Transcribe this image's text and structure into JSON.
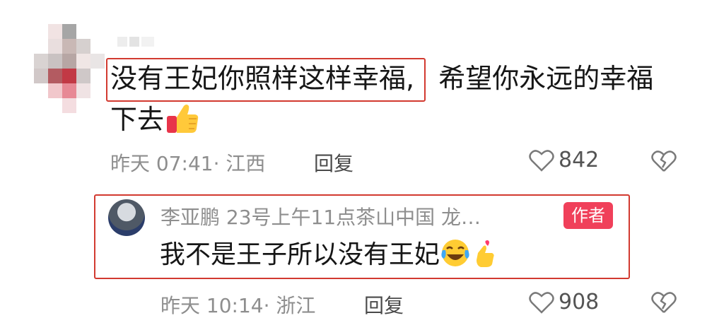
{
  "comment": {
    "line1_highlighted": "没有王妃你照样这样幸福,",
    "line1_rest": "希望你永远的幸福",
    "line2": "下去",
    "thumbs_emoji": "thumbs-up-icon",
    "meta": "昨天 07:41· 江西",
    "reply_label": "回复",
    "likes": "842"
  },
  "reply": {
    "author": "李亚鹏 23号上午11点茶山中国 龙…",
    "badge": "作者",
    "text": "我不是王子所以没有王妃",
    "meta": "昨天 10:14· 浙江",
    "reply_label": "回复",
    "likes": "908"
  },
  "colors": {
    "highlight": "#d23a30",
    "badge": "#f0405a",
    "meta_text": "#8e8e8e"
  }
}
